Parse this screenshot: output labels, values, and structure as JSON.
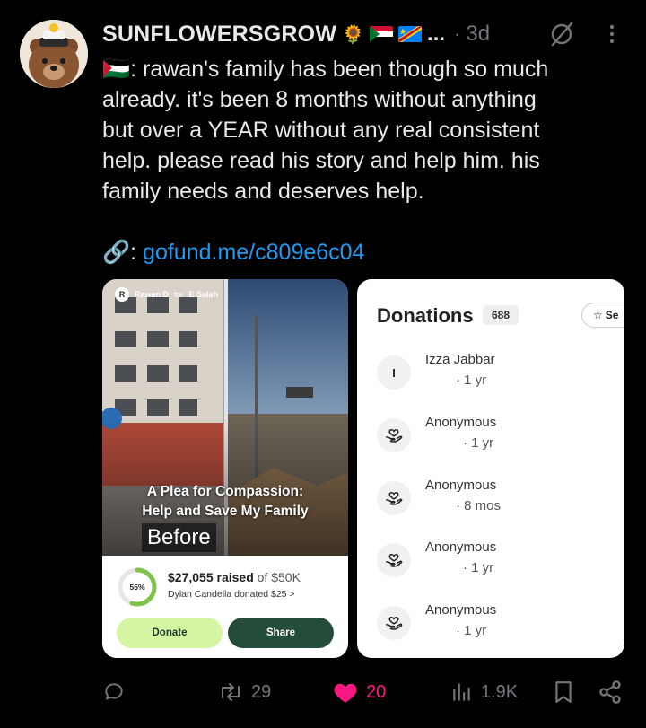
{
  "post": {
    "username": "SUNFLOWERSGROW",
    "username_emoji": "🌻",
    "ellipsis": "...",
    "separator": "·",
    "time": "3d",
    "text_flag": "🇵🇸",
    "text_lines": [
      ": rawan's family has been though so much",
      "already. it's been 8 months without anything",
      "but over a YEAR without any real consistent",
      "help. please read his story and help him. his",
      "family needs and deserves help."
    ],
    "link_emoji": "🔗",
    "link_colon": ":",
    "link_text": "gofund.me/c809e6c04"
  },
  "fundraiser": {
    "badge_initial": "R",
    "organizer": "Rawan D",
    "for_word": "for",
    "beneficiary": "E Salah",
    "title_line1": "A Plea for Compassion:",
    "title_line2": "Help and Save My Family",
    "before_label": "Before",
    "percent": 55,
    "percent_label": "55%",
    "raised_amount": "$27,055 raised",
    "goal": "of $50K",
    "recent_donor": "Dylan Candella donated $25 >",
    "donate_label": "Donate",
    "share_label": "Share"
  },
  "donations": {
    "title": "Donations",
    "count": "688",
    "see_label": "Se",
    "items": [
      {
        "name": "Izza Jabbar",
        "initial": "I",
        "time": "· 1 yr"
      },
      {
        "name": "Anonymous",
        "initial": "",
        "time": "· 1 yr"
      },
      {
        "name": "Anonymous",
        "initial": "",
        "time": "· 8 mos"
      },
      {
        "name": "Anonymous",
        "initial": "",
        "time": "· 1 yr"
      },
      {
        "name": "Anonymous",
        "initial": "",
        "time": "· 1 yr"
      }
    ]
  },
  "actions": {
    "replies": "",
    "reposts": "29",
    "likes": "20",
    "views": "1.9K"
  },
  "colors": {
    "accent": "#1d9bf0",
    "like": "#f91880",
    "muted": "#71767b",
    "donate_bg": "#d4f5a2",
    "share_bg": "#234d39",
    "progress": "#7ec24a"
  }
}
